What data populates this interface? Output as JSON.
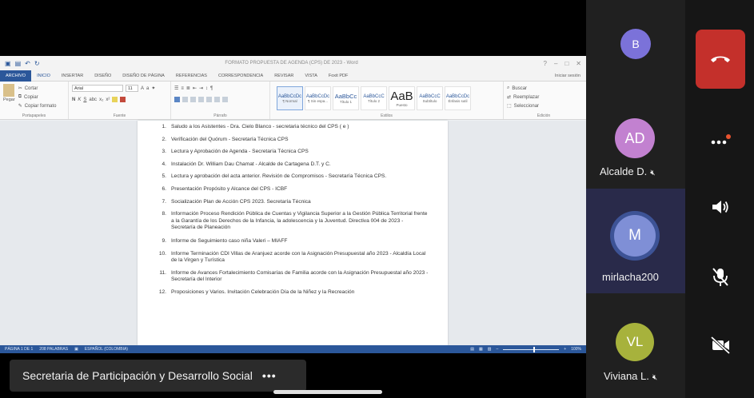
{
  "word": {
    "title": "FORMATO PROPUESTA DE AGENDA (CPS) DE 2023 - Word",
    "tabs": [
      "ARCHIVO",
      "INICIO",
      "INSERTAR",
      "DISEÑO",
      "DISEÑO DE PÁGINA",
      "REFERENCIAS",
      "CORRESPONDENCIA",
      "REVISAR",
      "VISTA",
      "Foxit PDF"
    ],
    "user": "Iniciar sesión",
    "clipboard": {
      "paste": "Pegar",
      "cut": "Cortar",
      "copy": "Copiar",
      "format_painter": "Copiar formato",
      "group": "Portapapeles"
    },
    "font": {
      "name": "Arial",
      "size": "11",
      "group": "Fuente"
    },
    "paragraph_group": "Párrafo",
    "styles": [
      {
        "preview": "AaBbCcDc",
        "name": "¶ Normal"
      },
      {
        "preview": "AaBbCcDc",
        "name": "¶ Sin espa..."
      },
      {
        "preview": "AaBbCc",
        "name": "Título 1"
      },
      {
        "preview": "AaBbCcC",
        "name": "Título 2"
      },
      {
        "preview": "AaB",
        "name": "Puesto"
      },
      {
        "preview": "AaBbCcC",
        "name": "Subtítulo"
      },
      {
        "preview": "AaBbCcDc",
        "name": "Énfasis sutil"
      }
    ],
    "styles_group": "Estilos",
    "editing": {
      "find": "Buscar",
      "replace": "Reemplazar",
      "select": "Seleccionar",
      "group": "Edición"
    },
    "agenda": [
      {
        "num": "1.",
        "text": "Saludo a los Asistentes - Dra. Cielo Blanco - secretaria técnico del CPS ( e )"
      },
      {
        "num": "2.",
        "text": "Verificación del Quórum - Secretaría Técnica CPS"
      },
      {
        "num": "3.",
        "text": "Lectura y Aprobación de Agenda - Secretaría Técnica CPS"
      },
      {
        "num": "4.",
        "text": "Instalación Dr. William Dau Chamat - Alcalde de Cartagena D.T. y C."
      },
      {
        "num": "5.",
        "text": "Lectura y aprobación del acta anterior. Revisión de Compromisos - Secretaría Técnica CPS."
      },
      {
        "num": "6.",
        "text": "Presentación Propósito y Alcance del CPS - ICBF"
      },
      {
        "num": "7.",
        "text": "Socialización Plan de Acción CPS 2023. Secretaría Técnica"
      },
      {
        "num": "8.",
        "text": "Información Proceso Rendición Pública de Cuentas y Vigilancia Superior a la Gestión Pública Territorial frente a la Garantía de los Derechos de la Infancia, la adolescencia y la Juventud. Directiva 004 de 2023 - Secretaría de Planeación"
      },
      {
        "num": "9.",
        "text": "Informe de Seguimiento caso niña Valeri – MIAFF"
      },
      {
        "num": "10.",
        "text": "Informe Terminación CDI Villas de Aranjuez acorde con la Asignación Presupuestal año 2023 - Alcaldía Local de la Virgen y Turística"
      },
      {
        "num": "11.",
        "text": "Informe de Avances Fortalecimiento Comisarías de Familia acorde con la Asignación Presupuestal año 2023 - Secretaría del Interior"
      },
      {
        "num": "12.",
        "text": "Proposiciones y Varios. Invitación Celebración Día de la Niñez y la Recreación"
      }
    ],
    "status": {
      "page": "PÁGINA 1 DE 1",
      "words": "208 PALABRAS",
      "lang": "ESPAÑOL (COLOMBIA)",
      "zoom": "100%"
    }
  },
  "banner": {
    "text": "Secretaria de Participación y Desarrollo Social",
    "more": "•••"
  },
  "participants": [
    {
      "initials": "B",
      "name": "",
      "color": "#7b72d9"
    },
    {
      "initials": "AD",
      "name": "Alcalde D.",
      "color": "#c281d0"
    },
    {
      "initials": "M",
      "name": "mirlacha200",
      "color": "#7f8fd6"
    },
    {
      "initials": "VL",
      "name": "Viviana L.",
      "color": "#a7b23c"
    }
  ],
  "colors": {
    "hangup": "#c4302b",
    "notify_dot": "#e8532f",
    "speaker_bg": "#292a4a",
    "word_blue": "#2b579a"
  },
  "icons": [
    "phone-hangup-icon",
    "more-icon",
    "speaker-icon",
    "mic-off-icon",
    "video-off-icon",
    "mute-icon"
  ]
}
